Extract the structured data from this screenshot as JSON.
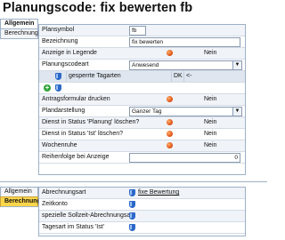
{
  "page": {
    "title": "Planungscode: fix bewerten fb"
  },
  "tabs_top": [
    {
      "label": "Allgemein",
      "state": "active"
    },
    {
      "label": "Berechnung",
      "state": "normal"
    }
  ],
  "general": {
    "plansymbol": {
      "label": "Plansymbol",
      "value": "fb"
    },
    "bezeichnung": {
      "label": "Bezeichnung",
      "value": "fix bewerten"
    },
    "anzeige_legende": {
      "label": "Anzeige in Legende",
      "value": "Nein"
    },
    "planungscodeart": {
      "label": "Planungscodeart",
      "value": "Anwesend"
    },
    "grid": {
      "col1": "gesperrte Tagarten",
      "col2": "DK",
      "col3": "<-"
    },
    "antragsformular": {
      "label": "Antragsformular drucken",
      "value": "Nein"
    },
    "plandarstellung": {
      "label": "Plandarstellung",
      "value": "Ganzer Tag"
    },
    "dienst_planung": {
      "label": "Dienst in Status 'Planung' löschen?",
      "value": "Nein"
    },
    "dienst_ist": {
      "label": "Dienst in Status 'Ist' löschen?",
      "value": "Nein"
    },
    "wochenruhe": {
      "label": "Wochenruhe",
      "value": "Nein"
    },
    "reihenfolge": {
      "label": "Reihenfolge bei Anzeige",
      "value": "0"
    }
  },
  "tabs_bottom": [
    {
      "label": "Allgemein",
      "state": "normal"
    },
    {
      "label": "Berechnung",
      "state": "selected"
    }
  ],
  "calc": {
    "abrechnungsart": {
      "label": "Abrechnungsart",
      "value": "fixe Bewertung"
    },
    "zeitkonto": {
      "label": "Zeitkonto"
    },
    "sollzeit": {
      "label": "spezielle Sollzeit-Abrechnungsart"
    },
    "tagesart": {
      "label": "Tagesart im Status 'Ist'"
    }
  },
  "colors": {
    "selected_tab": "#ffd64a",
    "status_dot": "#e2571c",
    "shield_icon": "#2c68c9",
    "add_icon": "#2fa43a"
  }
}
